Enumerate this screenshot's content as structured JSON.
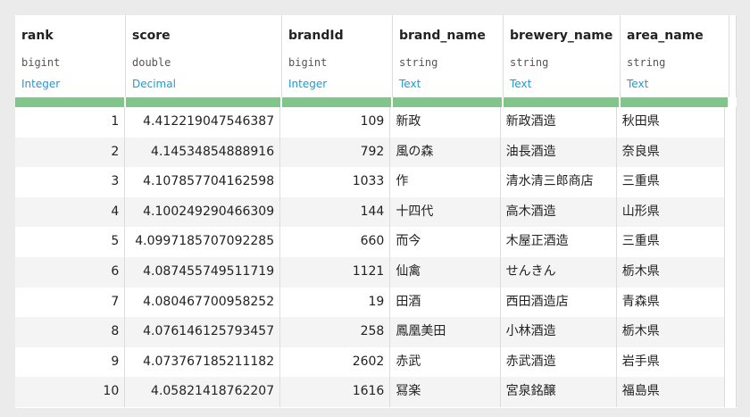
{
  "columns": [
    {
      "name": "rank",
      "storage": "bigint",
      "meaning": "Integer"
    },
    {
      "name": "score",
      "storage": "double",
      "meaning": "Decimal"
    },
    {
      "name": "brandId",
      "storage": "bigint",
      "meaning": "Integer"
    },
    {
      "name": "brand_name",
      "storage": "string",
      "meaning": "Text"
    },
    {
      "name": "brewery_name",
      "storage": "string",
      "meaning": "Text"
    },
    {
      "name": "area_name",
      "storage": "string",
      "meaning": "Text"
    }
  ],
  "colors": {
    "quality_bar": "#80c68a",
    "meaning_text": "#1a9bd7"
  },
  "rows": [
    [
      "1",
      "4.412219047546387",
      "109",
      "新政",
      "新政酒造",
      "秋田県"
    ],
    [
      "2",
      "4.14534854888916",
      "792",
      "風の森",
      "油長酒造",
      "奈良県"
    ],
    [
      "3",
      "4.107857704162598",
      "1033",
      "作",
      "清水清三郎商店",
      "三重県"
    ],
    [
      "4",
      "4.100249290466309",
      "144",
      "十四代",
      "高木酒造",
      "山形県"
    ],
    [
      "5",
      "4.0997185707092285",
      "660",
      "而今",
      "木屋正酒造",
      "三重県"
    ],
    [
      "6",
      "4.087455749511719",
      "1121",
      "仙禽",
      "せんきん",
      "栃木県"
    ],
    [
      "7",
      "4.080467700958252",
      "19",
      "田酒",
      "西田酒造店",
      "青森県"
    ],
    [
      "8",
      "4.076146125793457",
      "258",
      "鳳凰美田",
      "小林酒造",
      "栃木県"
    ],
    [
      "9",
      "4.073767185211182",
      "2602",
      "赤武",
      "赤武酒造",
      "岩手県"
    ],
    [
      "10",
      "4.05821418762207",
      "1616",
      "冩楽",
      "宮泉銘醸",
      "福島県"
    ]
  ]
}
